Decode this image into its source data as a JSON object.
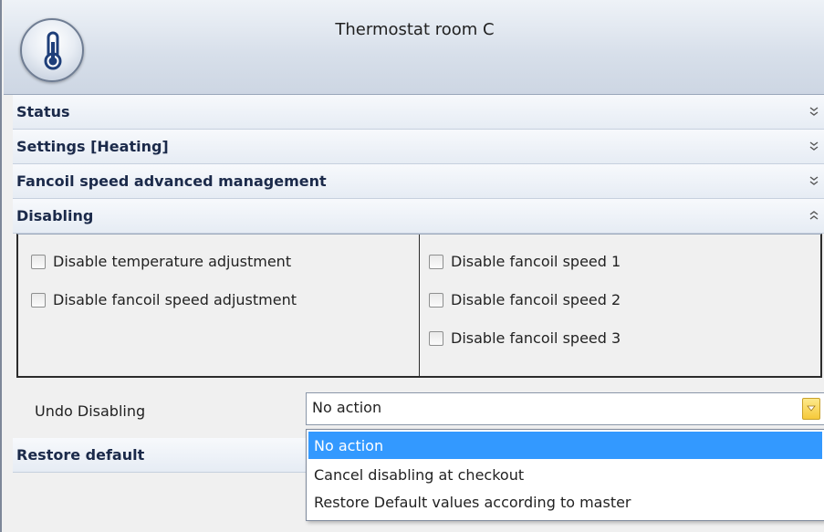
{
  "window": {
    "title": "Thermostat room C"
  },
  "app_icon": "thermometer-icon",
  "sections": [
    {
      "title": "Status",
      "state": "collapsed"
    },
    {
      "title": "Settings [Heating]",
      "state": "collapsed"
    },
    {
      "title": "Fancoil speed advanced management",
      "state": "collapsed"
    },
    {
      "title": "Disabling",
      "state": "expanded"
    }
  ],
  "disabling": {
    "left_options": [
      {
        "label": "Disable temperature adjustment",
        "checked": false
      },
      {
        "label": "Disable fancoil speed adjustment",
        "checked": false
      }
    ],
    "right_options": [
      {
        "label": "Disable fancoil speed 1",
        "checked": false
      },
      {
        "label": "Disable fancoil speed 2",
        "checked": false
      },
      {
        "label": "Disable fancoil speed 3",
        "checked": false
      }
    ],
    "undo_label": "Undo Disabling",
    "undo_value": "No action",
    "undo_options": [
      "No action",
      "Cancel disabling at checkout",
      "Restore Default values according to master"
    ],
    "selected_option": "No action"
  },
  "restore_section": {
    "title": "Restore default"
  },
  "colors": {
    "selection": "#3399ff",
    "dropdown_button": "#f6c93a"
  }
}
